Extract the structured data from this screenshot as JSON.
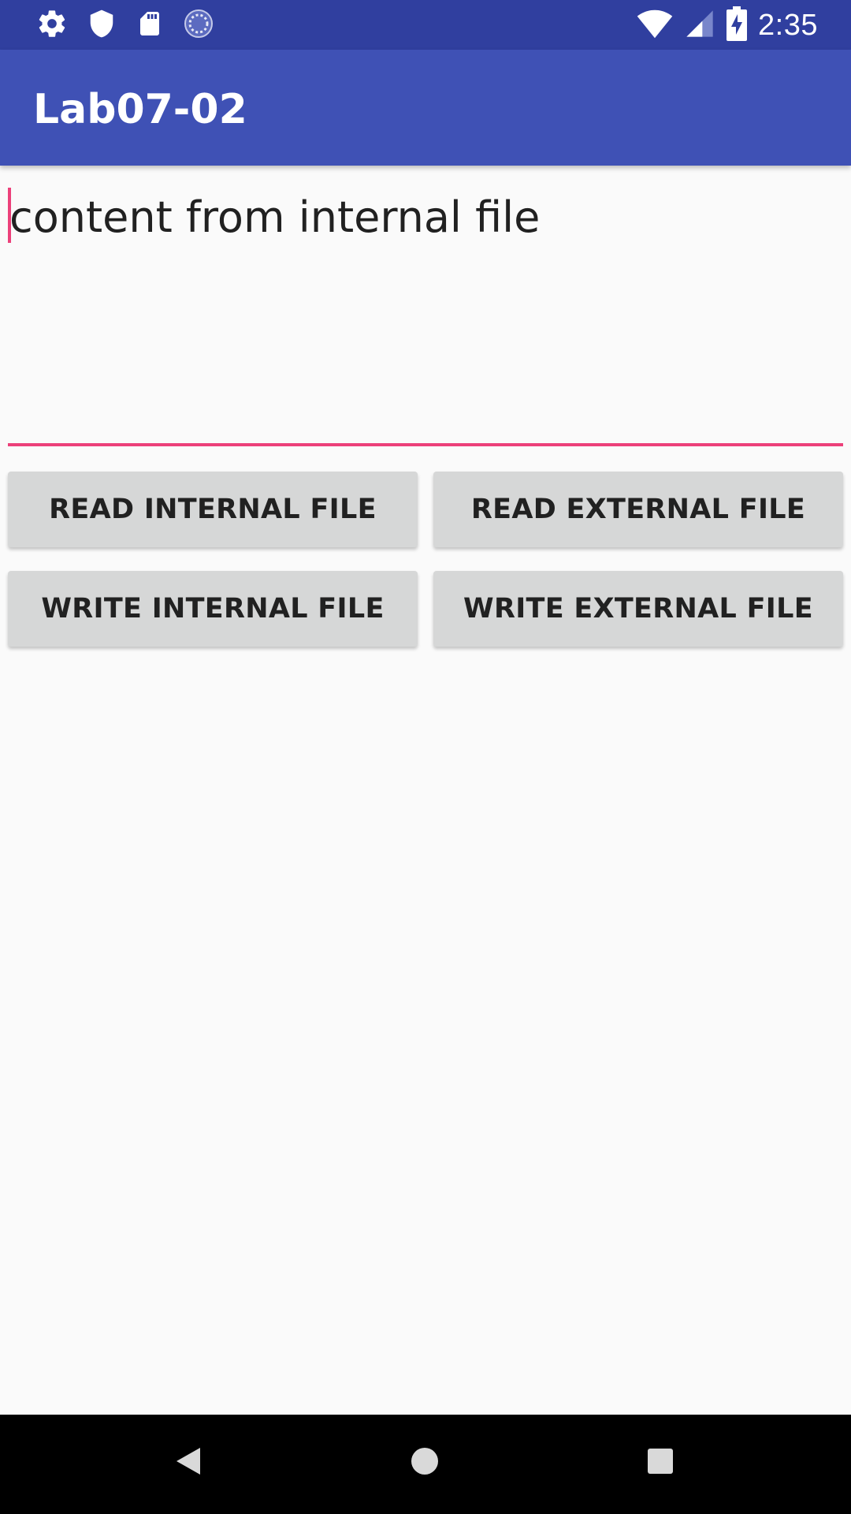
{
  "status_bar": {
    "time": "2:35",
    "left_icons": [
      "settings-icon",
      "shield-icon",
      "sd-card-icon",
      "sync-icon"
    ],
    "right_icons": [
      "wifi-icon",
      "signal-icon",
      "battery-charging-icon"
    ]
  },
  "app_bar": {
    "title": "Lab07-02"
  },
  "editor": {
    "value": "content from internal file"
  },
  "buttons": {
    "read_internal": "READ INTERNAL FILE",
    "read_external": "READ EXTERNAL FILE",
    "write_internal": "WRITE INTERNAL FILE",
    "write_external": "WRITE EXTERNAL FILE"
  },
  "nav_bar": {
    "icons": [
      "back-icon",
      "home-icon",
      "recents-icon"
    ]
  },
  "colors": {
    "status_bar": "#303f9f",
    "app_bar": "#3f51b5",
    "accent": "#ec407a",
    "button": "#d6d7d7",
    "background": "#fafafa"
  }
}
